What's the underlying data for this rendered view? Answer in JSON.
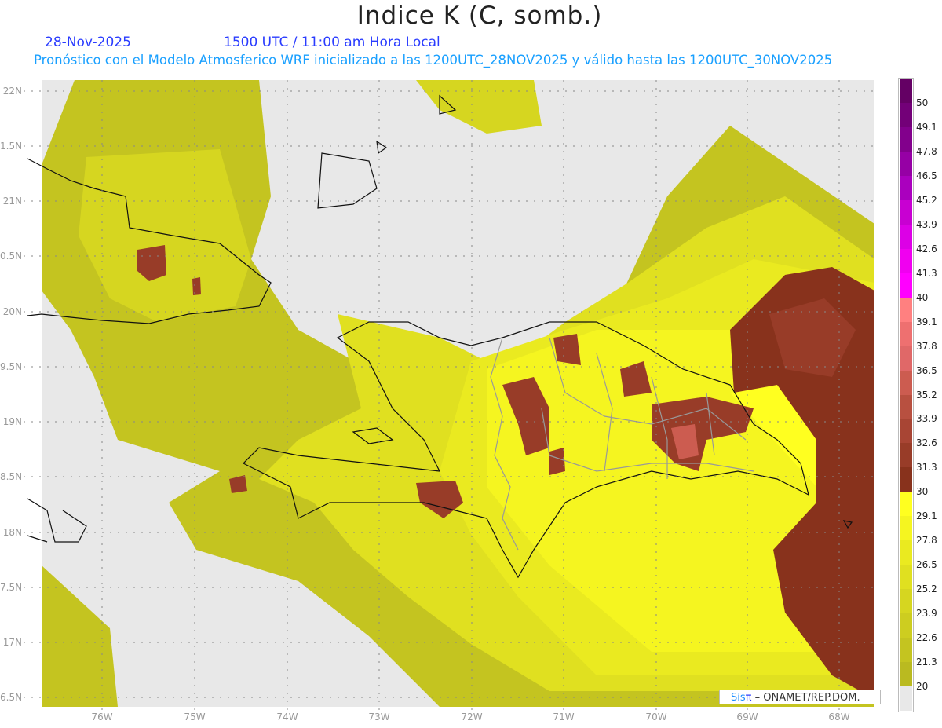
{
  "header": {
    "title": "Indice K (C, somb.)",
    "date": "28-Nov-2025",
    "time": "1500 UTC / 11:00 am Hora Local",
    "subtitle": "Pronóstico con el Modelo Atmosferico WRF inicializado a las 1200UTC_28NOV2025 y válido hasta las  1200UTC_30NOV2025"
  },
  "axes": {
    "y_ticks": [
      "22N",
      "1.5N",
      "21N",
      "0.5N",
      "20N",
      "9.5N",
      "19N",
      "8.5N",
      "18N",
      "7.5N",
      "17N",
      "6.5N"
    ],
    "x_ticks": [
      "76W",
      "75W",
      "74W",
      "73W",
      "72W",
      "71W",
      "70W",
      "69W",
      "68W"
    ]
  },
  "colorbar": {
    "labels": [
      "50",
      "49.1",
      "47.8",
      "46.5",
      "45.2",
      "43.9",
      "42.6",
      "41.3",
      "40",
      "39.1",
      "37.8",
      "36.5",
      "35.2",
      "33.9",
      "32.6",
      "31.3",
      "30",
      "29.1",
      "27.8",
      "26.5",
      "25.2",
      "23.9",
      "22.6",
      "21.3",
      "20"
    ],
    "colors": [
      "#640064",
      "#730078",
      "#82008c",
      "#9600a5",
      "#aa00be",
      "#c800d2",
      "#dc00e6",
      "#f000f0",
      "#ff00ff",
      "#ff8080",
      "#ee7070",
      "#e06868",
      "#cc5c50",
      "#b85040",
      "#a84534",
      "#983c28",
      "#88321c",
      "#ffff20",
      "#f5f520",
      "#eaea20",
      "#e0e020",
      "#d6d620",
      "#cdcd20",
      "#c4c420",
      "#baba20",
      "#e8e8e8"
    ]
  },
  "credits": {
    "sis": "Sis",
    "pi": "π",
    "org": "– ONAMET/REP.DOM."
  }
}
